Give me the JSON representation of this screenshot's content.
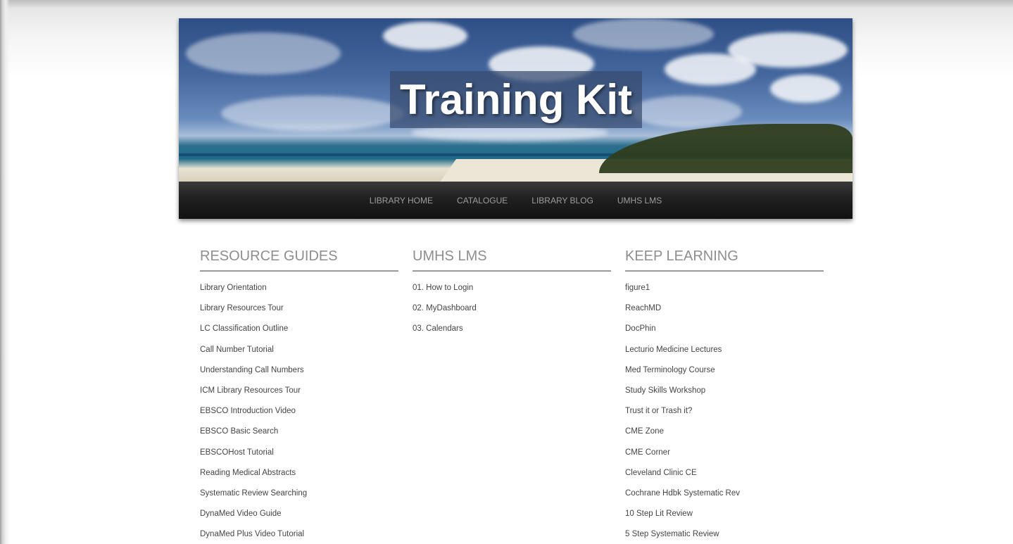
{
  "header": {
    "title": "Training Kit",
    "nav": [
      {
        "label": "LIBRARY HOME"
      },
      {
        "label": "CATALOGUE"
      },
      {
        "label": "LIBRARY BLOG"
      },
      {
        "label": "UMHS LMS"
      }
    ]
  },
  "columns": [
    {
      "heading": "RESOURCE GUIDES",
      "links": [
        "Library Orientation",
        "Library Resources Tour",
        "LC Classification Outline",
        "Call Number Tutorial",
        "Understanding Call Numbers",
        "ICM Library Resources Tour",
        "EBSCO Introduction Video",
        "EBSCO Basic Search",
        "EBSCOHost Tutorial",
        "Reading Medical Abstracts",
        "Systematic Review Searching",
        "DynaMed Video Guide",
        "DynaMed Plus Video Tutorial"
      ]
    },
    {
      "heading": "UMHS LMS",
      "links": [
        "01. How to Login",
        "02. MyDashboard",
        "03. Calendars"
      ]
    },
    {
      "heading": "KEEP LEARNING",
      "links": [
        "figure1",
        "ReachMD",
        "DocPhin",
        "Lecturio Medicine Lectures",
        "Med Terminology Course",
        "Study Skills Workshop",
        "Trust it or Trash it?",
        "CME Zone",
        "CME Corner",
        "Cleveland Clinic CE",
        "Cochrane Hdbk Systematic Rev",
        "10 Step Lit Review",
        "5 Step Systematic Review"
      ]
    }
  ],
  "colors": {
    "nav_bg": "#1a1a1a",
    "nav_text": "#9d9d9d",
    "heading_text": "#8e8e8e",
    "link_text": "#444444",
    "title_box": "#374b6e"
  }
}
